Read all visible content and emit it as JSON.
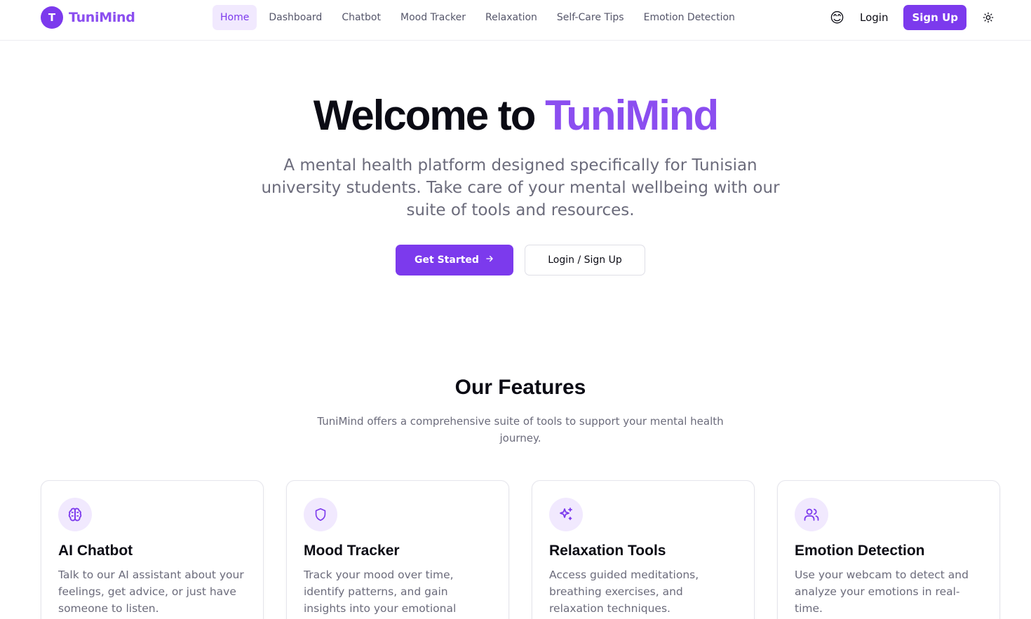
{
  "brand": {
    "logo_letter": "T",
    "name": "TuniMind",
    "accent_color": "#7c3aed"
  },
  "nav": {
    "items": [
      {
        "label": "Home",
        "active": true
      },
      {
        "label": "Dashboard"
      },
      {
        "label": "Chatbot"
      },
      {
        "label": "Mood Tracker"
      },
      {
        "label": "Relaxation"
      },
      {
        "label": "Self-Care Tips"
      },
      {
        "label": "Emotion Detection"
      }
    ]
  },
  "header_actions": {
    "mood_emoji": "😊",
    "login_label": "Login",
    "signup_label": "Sign Up",
    "theme_icon": "sun-icon"
  },
  "hero": {
    "title_prefix": "Welcome to ",
    "title_accent": "TuniMind",
    "subtitle": "A mental health platform designed specifically for Tunisian university students. Take care of your mental wellbeing with our suite of tools and resources.",
    "primary_cta": "Get Started",
    "secondary_cta": "Login / Sign Up"
  },
  "features": {
    "title": "Our Features",
    "subtitle": "TuniMind offers a comprehensive suite of tools to support your mental health journey.",
    "cards": [
      {
        "icon": "brain-icon",
        "title": "AI Chatbot",
        "text": "Talk to our AI assistant about your feelings, get advice, or just have someone to listen."
      },
      {
        "icon": "shield-icon",
        "title": "Mood Tracker",
        "text": "Track your mood over time, identify patterns, and gain insights into your emotional"
      },
      {
        "icon": "sparkles-icon",
        "title": "Relaxation Tools",
        "text": "Access guided meditations, breathing exercises, and relaxation techniques."
      },
      {
        "icon": "users-icon",
        "title": "Emotion Detection",
        "text": "Use your webcam to detect and analyze your emotions in real-time."
      }
    ]
  }
}
